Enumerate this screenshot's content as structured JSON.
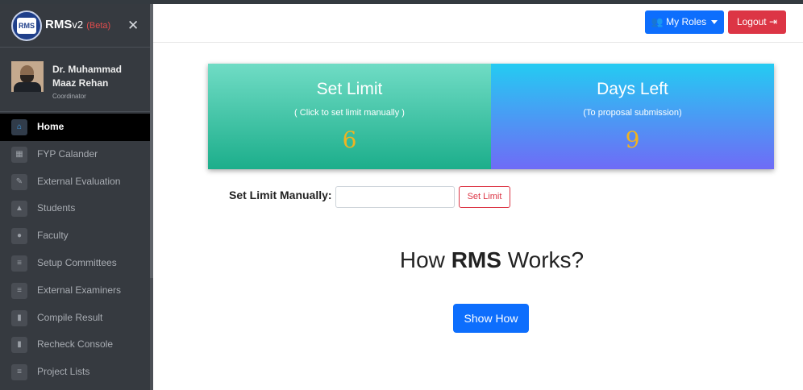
{
  "app": {
    "brand_name": "RMS",
    "brand_version": "v2",
    "brand_beta": "(Beta)",
    "logo_text": "RMS"
  },
  "user": {
    "name": "Dr. Muhammad Maaz Rehan",
    "role": "Coordinator"
  },
  "sidebar": {
    "items": [
      {
        "label": "Home",
        "icon": "home-icon",
        "active": true
      },
      {
        "label": "FYP Calander",
        "icon": "calendar-icon"
      },
      {
        "label": "External Evaluation",
        "icon": "edit-icon"
      },
      {
        "label": "Students",
        "icon": "graduation-cap-icon"
      },
      {
        "label": "Faculty",
        "icon": "user-icon"
      },
      {
        "label": "Setup Committees",
        "icon": "list-icon"
      },
      {
        "label": "External Examiners",
        "icon": "list-icon"
      },
      {
        "label": "Compile Result",
        "icon": "clipboard-icon"
      },
      {
        "label": "Recheck Console",
        "icon": "clipboard-icon"
      },
      {
        "label": "Project Lists",
        "icon": "list-icon"
      }
    ]
  },
  "header": {
    "roles_label": "My Roles",
    "logout_label": "Logout"
  },
  "cards": {
    "set_limit": {
      "title": "Set Limit",
      "subtitle": "( Click to set limit manually )",
      "value": "6"
    },
    "days_left": {
      "title": "Days Left",
      "subtitle": "(To proposal submission)",
      "value": "9"
    }
  },
  "limit_form": {
    "label": "Set Limit Manually:",
    "value": "",
    "button_label": "Set Limit"
  },
  "how": {
    "prefix": "How",
    "bold": "RMS",
    "suffix": "Works?",
    "button_label": "Show How"
  },
  "colors": {
    "primary": "#0d6efd",
    "danger": "#dc3545",
    "sidebar_bg": "#363a40",
    "accent_value": "#f0b320"
  }
}
